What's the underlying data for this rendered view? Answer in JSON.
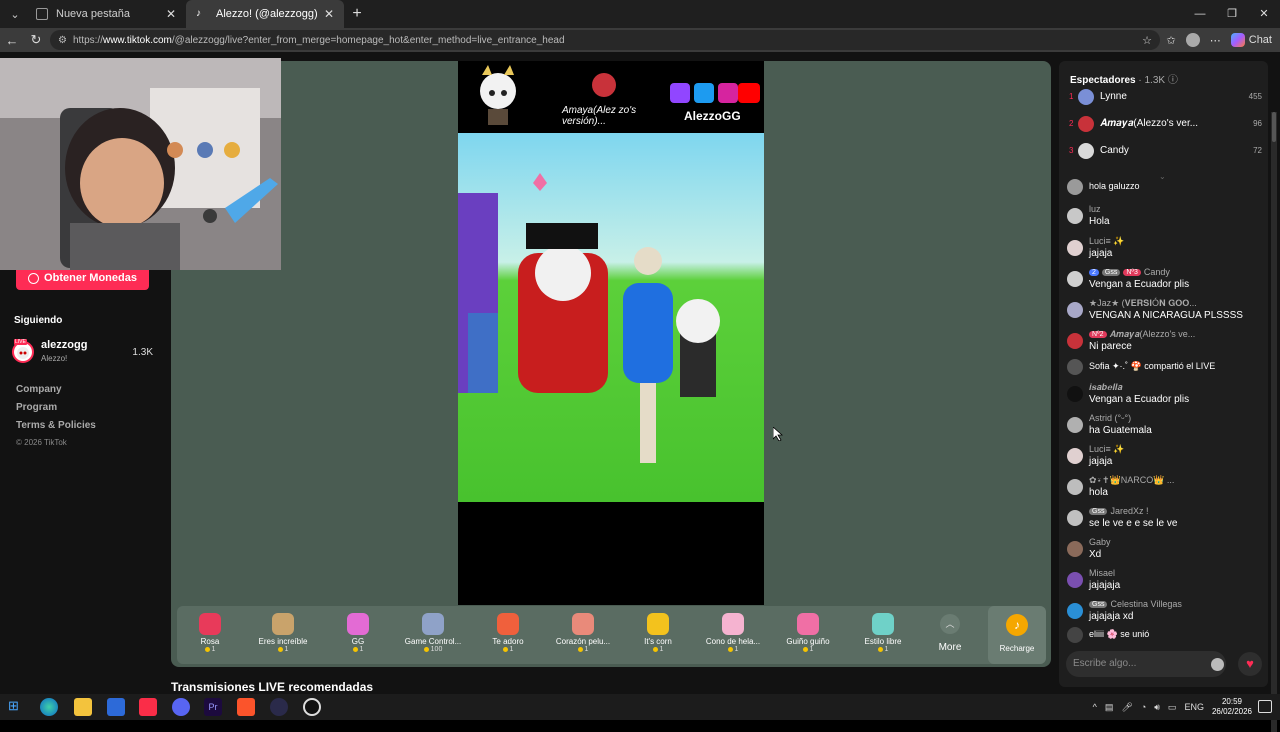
{
  "browser": {
    "tabs": [
      {
        "title": "Nueva pestaña",
        "active": false
      },
      {
        "title": "Alezzo! (@alezzogg) está LIVE: TikTok",
        "active": true
      }
    ],
    "url_prefix": "https://",
    "url_host": "www.tiktok.com",
    "url_path": "/@alezzogg/live?enter_from_merge=homepage_hot&enter_method=live_entrance_head",
    "chat_label": "Chat"
  },
  "sidebar": {
    "coins_button": "Obtener Monedas",
    "following_label": "Siguiendo",
    "following": [
      {
        "name": "alezzogg",
        "sub": "Alezzo!",
        "count": "1.3K",
        "badge": "LIVE"
      }
    ],
    "links": [
      "Company",
      "Program",
      "Terms & Policies"
    ],
    "copyright": "© 2026 TikTok"
  },
  "stream": {
    "overlay_name": "Amaya(Alez zo's versión)...",
    "overlay_brand": "AlezzoGG",
    "recommended_title": "Transmisiones LIVE recomendadas"
  },
  "gifts": [
    {
      "name": "Rosa",
      "cost": "1",
      "color": "#e83a5a"
    },
    {
      "name": "Eres increíble",
      "cost": "1",
      "color": "#c9a36b"
    },
    {
      "name": "GG",
      "cost": "1",
      "color": "#e36bd4"
    },
    {
      "name": "Game Control...",
      "cost": "100",
      "color": "#8fa2c8"
    },
    {
      "name": "Te adoro",
      "cost": "1",
      "color": "#f0603c"
    },
    {
      "name": "Corazón pelu...",
      "cost": "1",
      "color": "#e98a7a"
    },
    {
      "name": "It's corn",
      "cost": "1",
      "color": "#f3c21d"
    },
    {
      "name": "Cono de hela...",
      "cost": "1",
      "color": "#f5b3d0"
    },
    {
      "name": "Guiño guiño",
      "cost": "1",
      "color": "#f06fa5"
    },
    {
      "name": "Estilo libre",
      "cost": "1",
      "color": "#6fd1c8"
    }
  ],
  "gift_more": "More",
  "recharge": "Recharge",
  "chat": {
    "viewers_label": "Espectadores",
    "viewers_count": "· 1.3K",
    "ranking": [
      {
        "rank": "1",
        "name": "Lynne",
        "score": "455",
        "color": "#7a8fd6"
      },
      {
        "rank": "2",
        "name": "𝑨𝒎𝒂𝒚𝒂(Alezzo's ver...",
        "score": "96",
        "color": "#c8323a"
      },
      {
        "rank": "3",
        "name": "Candy",
        "score": "72",
        "color": "#d9d9d9"
      }
    ],
    "messages": [
      {
        "name": "hola galuzzo",
        "text": "",
        "avatar": "#9a9a9a"
      },
      {
        "name": "luz",
        "text": "Hola",
        "avatar": "#c8c8c8"
      },
      {
        "name": "Luci≡ ✨",
        "text": "jajaja",
        "avatar": "#e0d0d0"
      },
      {
        "name": "Candy",
        "text": "Vengan a Ecuador plis",
        "avatar": "#d0d0d0",
        "badges": [
          "2",
          "Gss",
          "Nº3"
        ]
      },
      {
        "name": "★Jaz★ (𝐕𝐄𝐑𝐒𝐈Ó𝐍 𝐆𝐎𝐎...",
        "text": "VENGAN A NICARAGUA PLSSSS",
        "avatar": "#a8a8c8"
      },
      {
        "name": "𝑨𝒎𝒂𝒚𝒂(Alezzo's ve...",
        "text": "Ni parece",
        "avatar": "#c8323a",
        "badges": [
          "Nº2"
        ]
      },
      {
        "name": "Sofia ✦·.˚ 🍄 compartió el LIVE",
        "text": "",
        "avatar": "#555555"
      },
      {
        "name": "𝒊𝒔𝒂𝒃𝒆𝒍𝒍𝒂",
        "text": "Vengan a Ecuador plis",
        "avatar": "#111111"
      },
      {
        "name": "Astrid (°ᵕ°)",
        "text": "ha Guatemala",
        "avatar": "#b0b0b0"
      },
      {
        "name": "Luci≡ ✨",
        "text": "jajaja",
        "avatar": "#e0d0d0"
      },
      {
        "name": "✿⍣✝👑NARCO👑 ...",
        "text": "hola",
        "avatar": "#bdbdbd"
      },
      {
        "name": "JaredXz !",
        "text": "se le ve e e se le ve",
        "avatar": "#c0c0c0",
        "badges": [
          "Gss"
        ]
      },
      {
        "name": "Gaby",
        "text": "Xd",
        "avatar": "#8a6a5a"
      },
      {
        "name": "Misael",
        "text": "jajajaja",
        "avatar": "#7a4fb0"
      },
      {
        "name": "Celestina Villegas",
        "text": "jajajaja xd",
        "avatar": "#2a8fd6",
        "badges": [
          "Gss"
        ]
      },
      {
        "name": "eliiii 🌸 se unió",
        "text": "",
        "avatar": "#444444"
      }
    ],
    "input_placeholder": "Escribe algo..."
  },
  "taskbar": {
    "lang": "ENG",
    "time": "20:59",
    "date": "26/02/2026"
  }
}
